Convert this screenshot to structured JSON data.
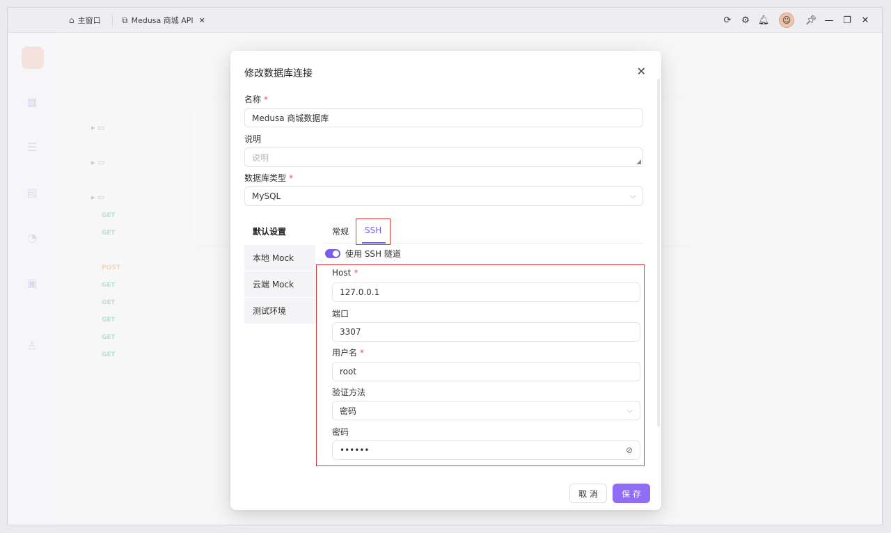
{
  "tabs": [
    {
      "label": "主窗口",
      "icon": "home-icon"
    },
    {
      "label": "Medusa 商城 API",
      "icon": "external-link-icon"
    }
  ],
  "system_icons": [
    "refresh-icon",
    "settings-icon",
    "bell-icon",
    "avatar",
    "pin-icon",
    "minimize-icon",
    "restore-icon",
    "close-icon"
  ],
  "modal": {
    "title": "修改数据库连接",
    "name_label": "名称",
    "name_value": "Medusa 商城数据库",
    "desc_label": "说明",
    "desc_placeholder": "说明",
    "db_type_label": "数据库类型",
    "db_type_value": "MySQL",
    "env_items": [
      "默认设置",
      "本地 Mock",
      "云端 Mock",
      "测试环境"
    ],
    "subtabs": [
      "常规",
      "SSH"
    ],
    "ssh_toggle_label": "使用 SSH 隧道",
    "host_label": "Host",
    "host_value": "127.0.0.1",
    "port_label": "端口",
    "port_value": "3307",
    "user_label": "用户名",
    "user_value": "root",
    "auth_label": "验证方法",
    "auth_value": "密码",
    "password_label": "密码",
    "password_value": "••••••",
    "cancel": "取 消",
    "save": "保 存"
  },
  "colors": {
    "accent": "#8f6ef5",
    "highlight": "#e0343b",
    "required": "#ef4a5c"
  }
}
